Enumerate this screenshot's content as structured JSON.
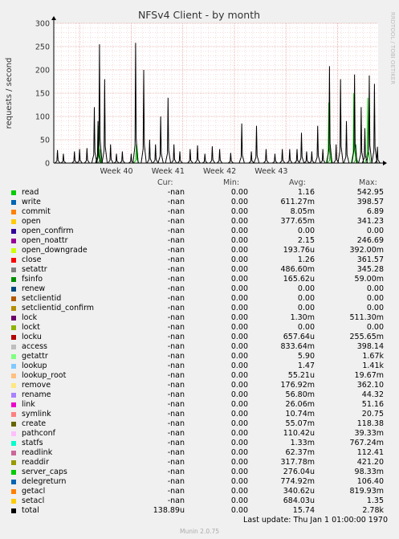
{
  "chart_data": {
    "type": "line",
    "title": "NFSv4 Client - by month",
    "ylabel": "requests / second",
    "ylim": [
      0,
      300
    ],
    "yticks": [
      0,
      50,
      100,
      150,
      200,
      250,
      300
    ],
    "x_week_labels": [
      "Week 40",
      "Week 41",
      "Week 42",
      "Week 43"
    ],
    "grid": true,
    "series": [
      {
        "name": "total",
        "color": "#000000",
        "spikes": [
          [
            0.5,
            28
          ],
          [
            1.3,
            20
          ],
          [
            2.8,
            25
          ],
          [
            3.5,
            30
          ],
          [
            4.5,
            32
          ],
          [
            5.5,
            120
          ],
          [
            6.0,
            90
          ],
          [
            6.2,
            255
          ],
          [
            6.9,
            180
          ],
          [
            7.7,
            40
          ],
          [
            8.5,
            20
          ],
          [
            9.3,
            25
          ],
          [
            10.5,
            20
          ],
          [
            11.1,
            258
          ],
          [
            12.2,
            200
          ],
          [
            13.0,
            50
          ],
          [
            13.8,
            40
          ],
          [
            14.5,
            100
          ],
          [
            15.5,
            140
          ],
          [
            16.3,
            40
          ],
          [
            17.1,
            25
          ],
          [
            18.5,
            30
          ],
          [
            19.5,
            38
          ],
          [
            20.5,
            20
          ],
          [
            21.5,
            36
          ],
          [
            22.5,
            30
          ],
          [
            24.0,
            22
          ],
          [
            25.5,
            85
          ],
          [
            26.8,
            25
          ],
          [
            27.5,
            80
          ],
          [
            28.8,
            30
          ],
          [
            30.0,
            20
          ],
          [
            31.0,
            30
          ],
          [
            32.0,
            30
          ],
          [
            33.0,
            30
          ],
          [
            33.6,
            65
          ],
          [
            34.3,
            25
          ],
          [
            35.0,
            25
          ],
          [
            35.8,
            80
          ],
          [
            36.5,
            30
          ],
          [
            37.4,
            208
          ],
          [
            38.3,
            40
          ],
          [
            38.9,
            180
          ],
          [
            39.7,
            90
          ],
          [
            40.8,
            190
          ],
          [
            41.7,
            120
          ],
          [
            42.2,
            75
          ],
          [
            42.8,
            188
          ],
          [
            43.5,
            170
          ],
          [
            43.9,
            35
          ]
        ]
      },
      {
        "name": "read",
        "color": "#00cc00",
        "spikes": [
          [
            6.1,
            80
          ],
          [
            11.2,
            40
          ],
          [
            37.3,
            130
          ],
          [
            40.7,
            150
          ],
          [
            42.6,
            140
          ]
        ]
      },
      {
        "name": "access",
        "color": "#3c8f3c",
        "spikes": [
          [
            6.3,
            30
          ],
          [
            37.5,
            40
          ],
          [
            41.0,
            40
          ]
        ]
      }
    ]
  },
  "legend_header": {
    "cur": "Cur:",
    "min": "Min:",
    "avg": "Avg:",
    "max": "Max:"
  },
  "legend": [
    {
      "name": "read",
      "color": "#00cc00",
      "cur": "-nan",
      "min": "0.00",
      "avg": "1.16",
      "max": "542.95"
    },
    {
      "name": "write",
      "color": "#0066b3",
      "cur": "-nan",
      "min": "0.00",
      "avg": "611.27m",
      "max": "398.57"
    },
    {
      "name": "commit",
      "color": "#ff8000",
      "cur": "-nan",
      "min": "0.00",
      "avg": "8.05m",
      "max": "6.89"
    },
    {
      "name": "open",
      "color": "#ffcc00",
      "cur": "-nan",
      "min": "0.00",
      "avg": "377.65m",
      "max": "341.23"
    },
    {
      "name": "open_confirm",
      "color": "#330099",
      "cur": "-nan",
      "min": "0.00",
      "avg": "0.00",
      "max": "0.00"
    },
    {
      "name": "open_noattr",
      "color": "#990099",
      "cur": "-nan",
      "min": "0.00",
      "avg": "2.15",
      "max": "246.69"
    },
    {
      "name": "open_downgrade",
      "color": "#ccff00",
      "cur": "-nan",
      "min": "0.00",
      "avg": "193.76u",
      "max": "392.00m"
    },
    {
      "name": "close",
      "color": "#ff0000",
      "cur": "-nan",
      "min": "0.00",
      "avg": "1.26",
      "max": "361.57"
    },
    {
      "name": "setattr",
      "color": "#808080",
      "cur": "-nan",
      "min": "0.00",
      "avg": "486.60m",
      "max": "345.28"
    },
    {
      "name": "fsinfo",
      "color": "#008f00",
      "cur": "-nan",
      "min": "0.00",
      "avg": "165.62u",
      "max": "59.00m"
    },
    {
      "name": "renew",
      "color": "#00487d",
      "cur": "-nan",
      "min": "0.00",
      "avg": "0.00",
      "max": "0.00"
    },
    {
      "name": "setclientid",
      "color": "#b35a00",
      "cur": "-nan",
      "min": "0.00",
      "avg": "0.00",
      "max": "0.00"
    },
    {
      "name": "setclientid_confirm",
      "color": "#b38f00",
      "cur": "-nan",
      "min": "0.00",
      "avg": "0.00",
      "max": "0.00"
    },
    {
      "name": "lock",
      "color": "#6b006b",
      "cur": "-nan",
      "min": "0.00",
      "avg": "1.30m",
      "max": "511.30m"
    },
    {
      "name": "lockt",
      "color": "#8fb300",
      "cur": "-nan",
      "min": "0.00",
      "avg": "0.00",
      "max": "0.00"
    },
    {
      "name": "locku",
      "color": "#b30000",
      "cur": "-nan",
      "min": "0.00",
      "avg": "657.64u",
      "max": "255.65m"
    },
    {
      "name": "access",
      "color": "#bebebe",
      "cur": "-nan",
      "min": "0.00",
      "avg": "833.64m",
      "max": "398.14"
    },
    {
      "name": "getattr",
      "color": "#80ff80",
      "cur": "-nan",
      "min": "0.00",
      "avg": "5.90",
      "max": "1.67k"
    },
    {
      "name": "lookup",
      "color": "#80c9ff",
      "cur": "-nan",
      "min": "0.00",
      "avg": "1.47",
      "max": "1.41k"
    },
    {
      "name": "lookup_root",
      "color": "#ffc080",
      "cur": "-nan",
      "min": "0.00",
      "avg": "55.21u",
      "max": "19.67m"
    },
    {
      "name": "remove",
      "color": "#ffe680",
      "cur": "-nan",
      "min": "0.00",
      "avg": "176.92m",
      "max": "362.10"
    },
    {
      "name": "rename",
      "color": "#aa80ff",
      "cur": "-nan",
      "min": "0.00",
      "avg": "56.80m",
      "max": "44.32"
    },
    {
      "name": "link",
      "color": "#ee00cc",
      "cur": "-nan",
      "min": "0.00",
      "avg": "26.06m",
      "max": "51.16"
    },
    {
      "name": "symlink",
      "color": "#ff8080",
      "cur": "-nan",
      "min": "0.00",
      "avg": "10.74m",
      "max": "20.75"
    },
    {
      "name": "create",
      "color": "#666600",
      "cur": "-nan",
      "min": "0.00",
      "avg": "55.07m",
      "max": "118.38"
    },
    {
      "name": "pathconf",
      "color": "#ffbfff",
      "cur": "-nan",
      "min": "0.00",
      "avg": "110.42u",
      "max": "39.33m"
    },
    {
      "name": "statfs",
      "color": "#00ffcc",
      "cur": "-nan",
      "min": "0.00",
      "avg": "1.33m",
      "max": "767.24m"
    },
    {
      "name": "readlink",
      "color": "#cc6699",
      "cur": "-nan",
      "min": "0.00",
      "avg": "62.37m",
      "max": "112.41"
    },
    {
      "name": "readdir",
      "color": "#999900",
      "cur": "-nan",
      "min": "0.00",
      "avg": "317.78m",
      "max": "421.20"
    },
    {
      "name": "server_caps",
      "color": "#00cc00",
      "cur": "-nan",
      "min": "0.00",
      "avg": "276.04u",
      "max": "98.33m"
    },
    {
      "name": "delegreturn",
      "color": "#0066b3",
      "cur": "-nan",
      "min": "0.00",
      "avg": "774.92m",
      "max": "106.40"
    },
    {
      "name": "getacl",
      "color": "#ff8000",
      "cur": "-nan",
      "min": "0.00",
      "avg": "340.62u",
      "max": "819.93m"
    },
    {
      "name": "setacl",
      "color": "#ffcc00",
      "cur": "-nan",
      "min": "0.00",
      "avg": "684.03u",
      "max": "1.35"
    },
    {
      "name": "total",
      "color": "#000000",
      "cur": "138.89u",
      "min": "0.00",
      "avg": "15.74",
      "max": "2.78k"
    }
  ],
  "last_update": "Last update: Thu Jan  1 01:00:00 1970",
  "side_label": "RRDTOOL / TOBI OETIKER",
  "munin_version": "Munin 2.0.75"
}
